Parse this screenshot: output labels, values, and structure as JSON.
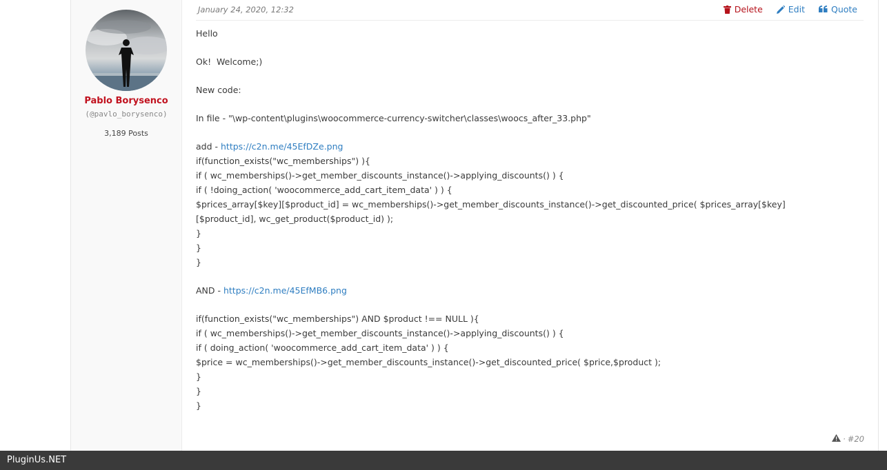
{
  "author": {
    "name": "Pablo Borysenco",
    "handle": "(@pavlo_borysenco)",
    "posts": "3,189 Posts"
  },
  "post": {
    "date": "January 24, 2020, 12:32",
    "actions": {
      "delete": "Delete",
      "edit": "Edit",
      "quote": "Quote"
    },
    "lines": [
      "Hello",
      "",
      "Ok!  Welcome;)",
      "",
      "New code:",
      "",
      "In file - \"\\wp-content\\plugins\\woocommerce-currency-switcher\\classes\\woocs_after_33.php\"",
      "",
      "add - ",
      "if(function_exists(\"wc_memberships\") ){",
      "if ( wc_memberships()->get_member_discounts_instance()->applying_discounts() ) {",
      "if ( !doing_action( 'woocommerce_add_cart_item_data' ) ) {",
      "$prices_array[$key][$product_id] = wc_memberships()->get_member_discounts_instance()->get_discounted_price( $prices_array[$key]",
      "[$product_id], wc_get_product($product_id) );",
      "}",
      "}",
      "}",
      "",
      "AND - ",
      "",
      "if(function_exists(\"wc_memberships\") AND $product !== NULL ){",
      "if ( wc_memberships()->get_member_discounts_instance()->applying_discounts() ) {",
      "if ( doing_action( 'woocommerce_add_cart_item_data' ) ) {",
      "$price = wc_memberships()->get_member_discounts_instance()->get_discounted_price( $price,$product );",
      "}",
      "}",
      "}"
    ],
    "link1": "https://c2n.me/45EfDZe.png",
    "link2": "https://c2n.me/45EfMB6.png",
    "footer_number": "#20",
    "footer_sep": "·"
  },
  "site": {
    "name": "PluginUs.NET"
  },
  "colors": {
    "accent": "#2f7ec1",
    "delete": "#b5121b",
    "author_name": "#c1121f",
    "bar": "#3a3a3a"
  },
  "icons": [
    "trash-icon",
    "pencil-icon",
    "quote-icon",
    "warning-icon"
  ]
}
